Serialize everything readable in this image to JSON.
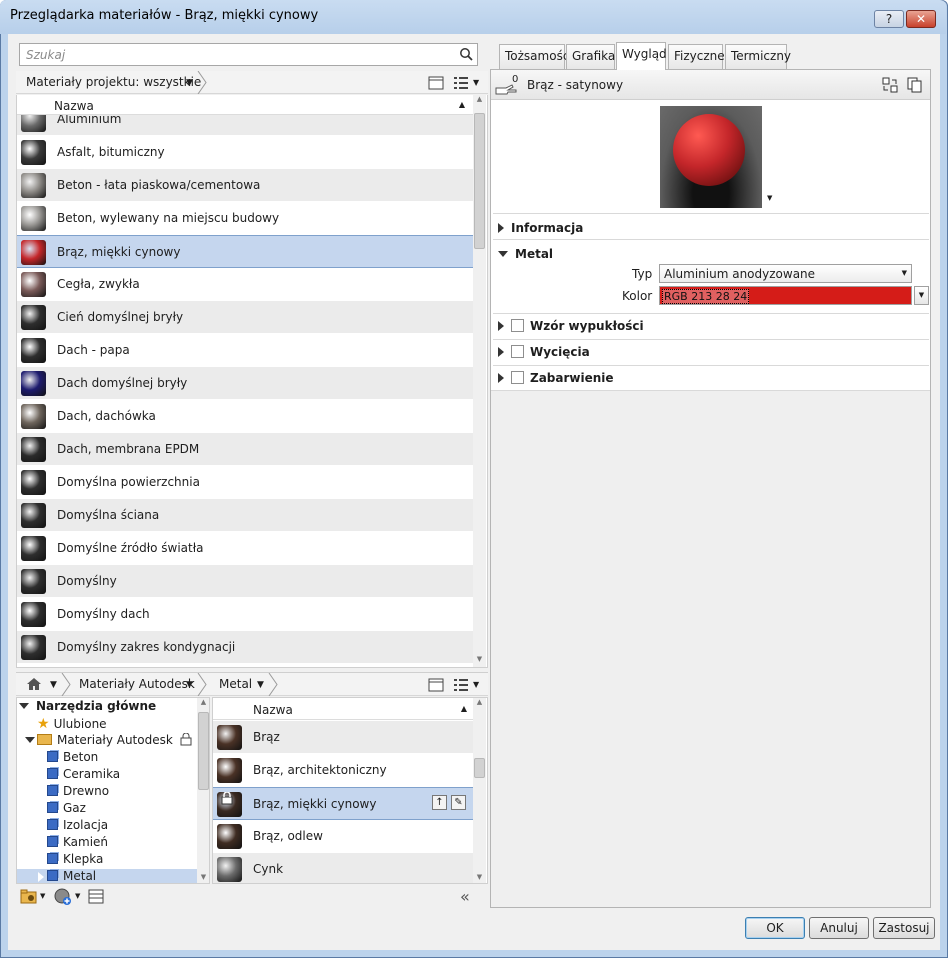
{
  "window": {
    "title": "Przeglądarka materiałów - Brąz, miękki cynowy",
    "help": "?",
    "close": "✕"
  },
  "search": {
    "placeholder": "Szukaj"
  },
  "project": {
    "filter": "Materiały projektu: wszystkie",
    "column": "Nazwa",
    "items": [
      {
        "label": "Aluminium",
        "thumb": "#6a6a6a"
      },
      {
        "label": "Asfalt, bitumiczny",
        "thumb": "#3a3a3a"
      },
      {
        "label": "Beton - łata piaskowa/cementowa",
        "thumb": "#8d8a86"
      },
      {
        "label": "Beton, wylewany na miejscu budowy",
        "thumb": "#9a9895"
      },
      {
        "label": "Brąz, miękki cynowy",
        "thumb": "#c4262a"
      },
      {
        "label": "Cegła, zwykła",
        "thumb": "#7a5a58"
      },
      {
        "label": "Cień domyślnej bryły",
        "thumb": "#2e2e2e"
      },
      {
        "label": "Dach - papa",
        "thumb": "#2e2e2e"
      },
      {
        "label": "Dach domyślnej bryły",
        "thumb": "#1d1b6e"
      },
      {
        "label": "Dach, dachówka",
        "thumb": "#6e655c"
      },
      {
        "label": "Dach, membrana EPDM",
        "thumb": "#2b2b2b"
      },
      {
        "label": "Domyślna powierzchnia",
        "thumb": "#2e2e2e"
      },
      {
        "label": "Domyślna ściana",
        "thumb": "#2e2e2e"
      },
      {
        "label": "Domyślne źródło światła",
        "thumb": "#2e2e2e"
      },
      {
        "label": "Domyślny",
        "thumb": "#2e2e2e"
      },
      {
        "label": "Domyślny dach",
        "thumb": "#2e2e2e"
      },
      {
        "label": "Domyślny zakres kondygnacji",
        "thumb": "#2e2e2e"
      }
    ]
  },
  "library": {
    "crumb1": "Materiały Autodesk",
    "crumb2": "Metal",
    "column": "Nazwa",
    "tree": [
      {
        "label": "Narzędzia główne"
      },
      {
        "label": "Ulubione"
      },
      {
        "label": "Materiały Autodesk"
      },
      {
        "label": "Beton"
      },
      {
        "label": "Ceramika"
      },
      {
        "label": "Drewno"
      },
      {
        "label": "Gaz"
      },
      {
        "label": "Izolacja"
      },
      {
        "label": "Kamień"
      },
      {
        "label": "Klepka"
      },
      {
        "label": "Metal"
      }
    ],
    "items": [
      {
        "label": "Brąz",
        "thumb": "#4a3226"
      },
      {
        "label": "Brąz, architektoniczny",
        "thumb": "#4a3226"
      },
      {
        "label": "Brąz, miękki cynowy",
        "thumb": "#3a2a22"
      },
      {
        "label": "Brąz, odlew",
        "thumb": "#3f2c22"
      },
      {
        "label": "Cynk",
        "thumb": "#6b6b6b"
      }
    ]
  },
  "tabs": [
    "Tożsamość",
    "Grafika",
    "Wygląd",
    "Fizyczne",
    "Termiczny"
  ],
  "asset": {
    "name": "Brąz - satynowy",
    "count": "0"
  },
  "props": {
    "info": "Informacja",
    "metal": "Metal",
    "type_label": "Typ",
    "type_value": "Aluminium anodyzowane",
    "color_label": "Kolor",
    "color_value": "RGB 213 28 24",
    "color_hex": "#d51c18",
    "relief": "Wzór wypukłości",
    "cutouts": "Wycięcia",
    "tint": "Zabarwienie"
  },
  "buttons": {
    "ok": "OK",
    "cancel": "Anuluj",
    "apply": "Zastosuj"
  }
}
